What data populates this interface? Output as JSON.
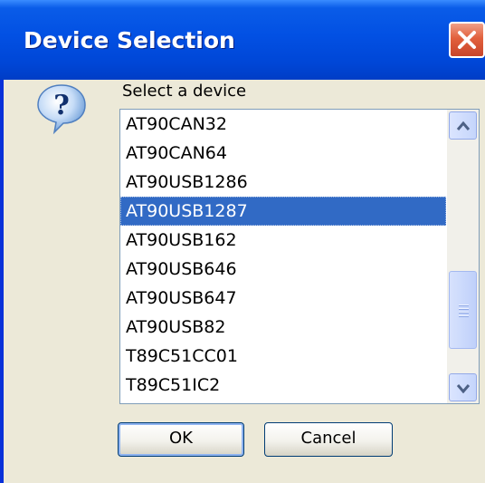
{
  "window": {
    "title": "Device Selection"
  },
  "prompt": "Select a device",
  "device_list": {
    "items": [
      "AT90CAN32",
      "AT90CAN64",
      "AT90USB1286",
      "AT90USB1287",
      "AT90USB162",
      "AT90USB646",
      "AT90USB647",
      "AT90USB82",
      "T89C51CC01",
      "T89C51IC2"
    ],
    "selected": "AT90USB1287"
  },
  "buttons": {
    "ok": "OK",
    "cancel": "Cancel"
  },
  "colors": {
    "titlebar": "#0250e3",
    "selection": "#316ac5",
    "dialog_bg": "#ece9d8"
  }
}
